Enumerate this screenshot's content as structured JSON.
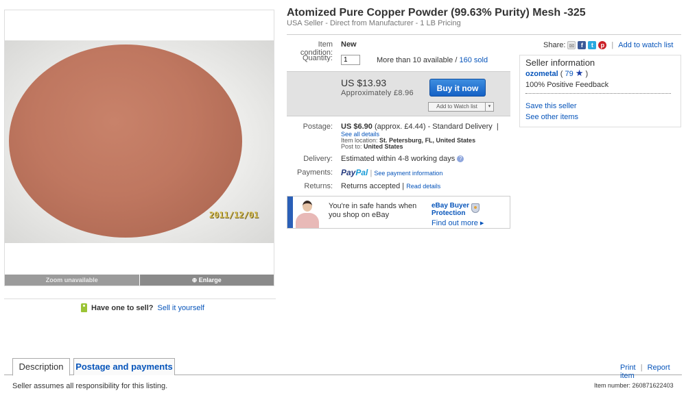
{
  "listing": {
    "title": "Atomized Pure Copper Powder (99.63% Purity) Mesh -325",
    "subtitle": "USA Seller - Direct from Manufacturer - 1 LB Pricing"
  },
  "image": {
    "date_stamp": "2011/12/01",
    "zoom_label": "Zoom unavailable",
    "enlarge_label": "Enlarge"
  },
  "sell_prompt": {
    "question": "Have one to sell?",
    "link": "Sell it yourself"
  },
  "details": {
    "condition_label": "Item condition:",
    "condition_value": "New",
    "quantity_label": "Quantity:",
    "quantity_value": "1",
    "availability": "More than 10 available /",
    "sold_link": "160 sold",
    "postage_label": "Postage:",
    "postage_price": "US $6.90",
    "postage_rest": "(approx. £4.44) - Standard Delivery",
    "postage_sep": "|",
    "see_all_details": "See all details",
    "item_location_label": "Item location:",
    "item_location": "St. Petersburg, FL, United States",
    "post_to_label": "Post to:",
    "post_to": "United States",
    "delivery_label": "Delivery:",
    "delivery_value": "Estimated within 4-8 working days",
    "payments_label": "Payments:",
    "paypal_part1": "Pay",
    "paypal_part2": "Pal",
    "payment_sep": "|",
    "payment_link": "See payment information",
    "returns_label": "Returns:",
    "returns_value": "Returns accepted",
    "returns_sep": "|",
    "returns_link": "Read details"
  },
  "buy_box": {
    "price": "US $13.93",
    "approx": "Approximately £8.96",
    "buy_label": "Buy it now",
    "watch_label": "Add to Watch list",
    "watch_arrow": "▾"
  },
  "protection": {
    "text": "You're in safe hands when you shop on eBay",
    "title": "eBay Buyer Protection",
    "link": "Find out more ▸"
  },
  "share": {
    "label": "Share:",
    "sep": "|",
    "watch_link": "Add to watch list",
    "email_icon": "✉",
    "facebook_icon": "f",
    "twitter_icon": "t",
    "pinterest_icon": "p"
  },
  "seller": {
    "heading": "Seller information",
    "name": "ozometal",
    "score_open": "(",
    "score": "79",
    "score_close": ")",
    "feedback": "100% Positive Feedback",
    "save": "Save this seller",
    "other": "See other items"
  },
  "tabs": [
    {
      "label": "Description"
    },
    {
      "label": "Postage and payments"
    }
  ],
  "actions": {
    "print": "Print",
    "sep": "|",
    "report": "Report item"
  },
  "footer": {
    "note": "Seller assumes all responsibility for this listing.",
    "item_number": "Item number: 260871622403"
  },
  "colors": {
    "link": "#0654ba",
    "buy_button": "#1561c5",
    "powder": "#bf7760"
  }
}
